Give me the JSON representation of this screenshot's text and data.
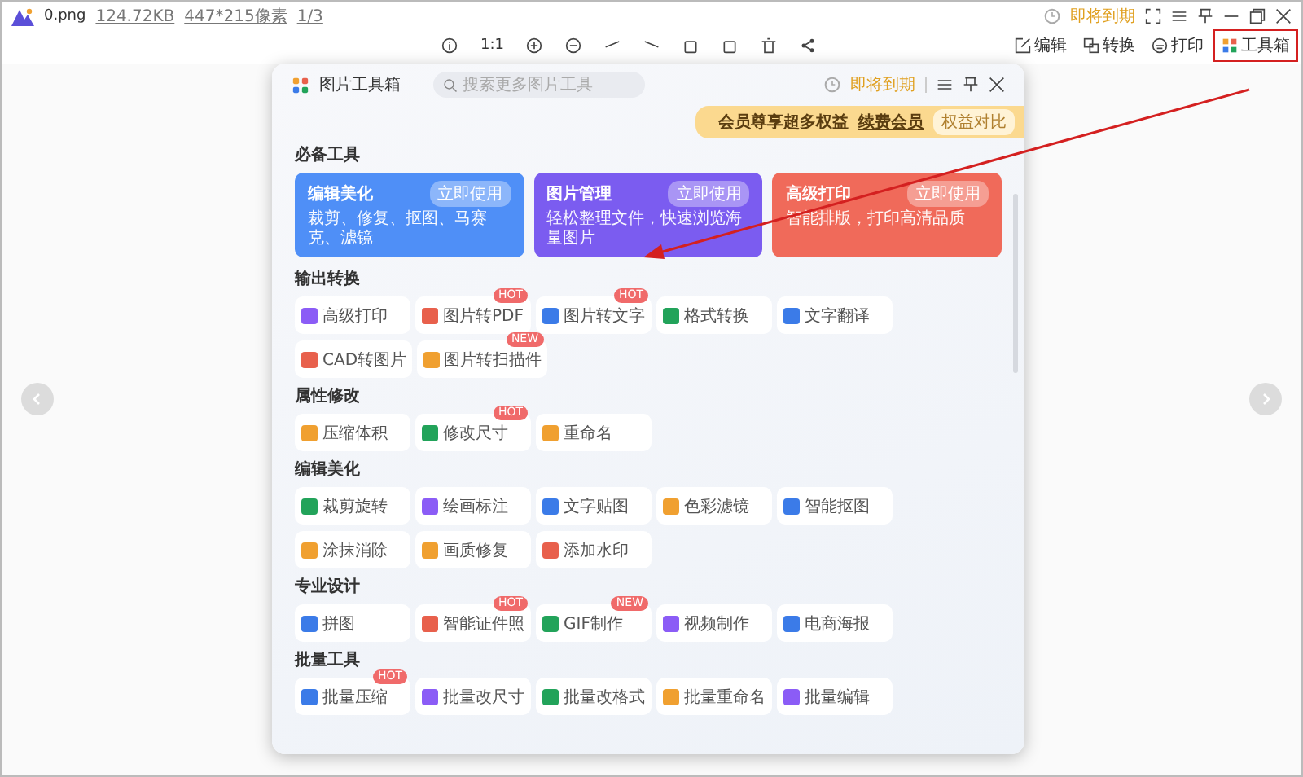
{
  "titlebar": {
    "file_name": "0.png",
    "file_size": "124.72KB",
    "dimensions": "447*215像素",
    "page": "1/3",
    "expiry": "即将到期"
  },
  "toolbar": {
    "zoom_ratio": "1:1",
    "actions": [
      {
        "label": "编辑",
        "kind": "edit",
        "highlighted": false
      },
      {
        "label": "转换",
        "kind": "convert",
        "highlighted": false
      },
      {
        "label": "打印",
        "kind": "print",
        "highlighted": false
      },
      {
        "label": "工具箱",
        "kind": "toolbox",
        "highlighted": true
      }
    ]
  },
  "dialog": {
    "title": "图片工具箱",
    "search": {
      "placeholder": "搜索更多图片工具"
    },
    "expiry": "即将到期",
    "promo": {
      "text": "会员尊享超多权益",
      "link": "续费会员",
      "button": "权益对比"
    },
    "featured": {
      "title": "必备工具",
      "cards": [
        {
          "title": "编辑美化",
          "button": "立即使用",
          "description": "裁剪、修复、抠图、马赛克、滤镜",
          "color": "#4f8ff7"
        },
        {
          "title": "图片管理",
          "button": "立即使用",
          "description": "轻松整理文件，快速浏览海量图片",
          "color": "#7b5cf0"
        },
        {
          "title": "高级打印",
          "button": "立即使用",
          "description": "智能排版，打印高清品质",
          "color": "#f06a5a"
        }
      ]
    },
    "sections": [
      {
        "title": "输出转换",
        "tools": [
          {
            "label": "高级打印",
            "color": "#8b5cf6"
          },
          {
            "label": "图片转PDF",
            "badge": "HOT",
            "color": "#e8604c"
          },
          {
            "label": "图片转文字",
            "badge": "HOT",
            "color": "#3b7be8"
          },
          {
            "label": "格式转换",
            "color": "#22a35a"
          },
          {
            "label": "文字翻译",
            "color": "#3b7be8"
          },
          {
            "label": "CAD转图片",
            "color": "#e8604c"
          },
          {
            "label": "图片转扫描件",
            "badge": "NEW",
            "color": "#f0a030"
          }
        ]
      },
      {
        "title": "属性修改",
        "tools": [
          {
            "label": "压缩体积",
            "color": "#f0a030"
          },
          {
            "label": "修改尺寸",
            "badge": "HOT",
            "color": "#22a35a"
          },
          {
            "label": "重命名",
            "color": "#f0a030"
          }
        ]
      },
      {
        "title": "编辑美化",
        "tools": [
          {
            "label": "裁剪旋转",
            "color": "#22a35a"
          },
          {
            "label": "绘画标注",
            "color": "#8b5cf6"
          },
          {
            "label": "文字贴图",
            "color": "#3b7be8"
          },
          {
            "label": "色彩滤镜",
            "color": "#f0a030"
          },
          {
            "label": "智能抠图",
            "color": "#3b7be8"
          },
          {
            "label": "涂抹消除",
            "color": "#f0a030"
          },
          {
            "label": "画质修复",
            "color": "#f0a030"
          },
          {
            "label": "添加水印",
            "color": "#e8604c"
          }
        ]
      },
      {
        "title": "专业设计",
        "tools": [
          {
            "label": "拼图",
            "color": "#3b7be8"
          },
          {
            "label": "智能证件照",
            "badge": "HOT",
            "color": "#e8604c"
          },
          {
            "label": "GIF制作",
            "badge": "NEW",
            "color": "#22a35a"
          },
          {
            "label": "视频制作",
            "color": "#8b5cf6"
          },
          {
            "label": "电商海报",
            "color": "#3b7be8"
          }
        ]
      },
      {
        "title": "批量工具",
        "tools": [
          {
            "label": "批量压缩",
            "badge": "HOT",
            "color": "#3b7be8"
          },
          {
            "label": "批量改尺寸",
            "color": "#8b5cf6"
          },
          {
            "label": "批量改格式",
            "color": "#22a35a"
          },
          {
            "label": "批量重命名",
            "color": "#f0a030"
          },
          {
            "label": "批量编辑",
            "color": "#8b5cf6"
          }
        ]
      }
    ]
  }
}
